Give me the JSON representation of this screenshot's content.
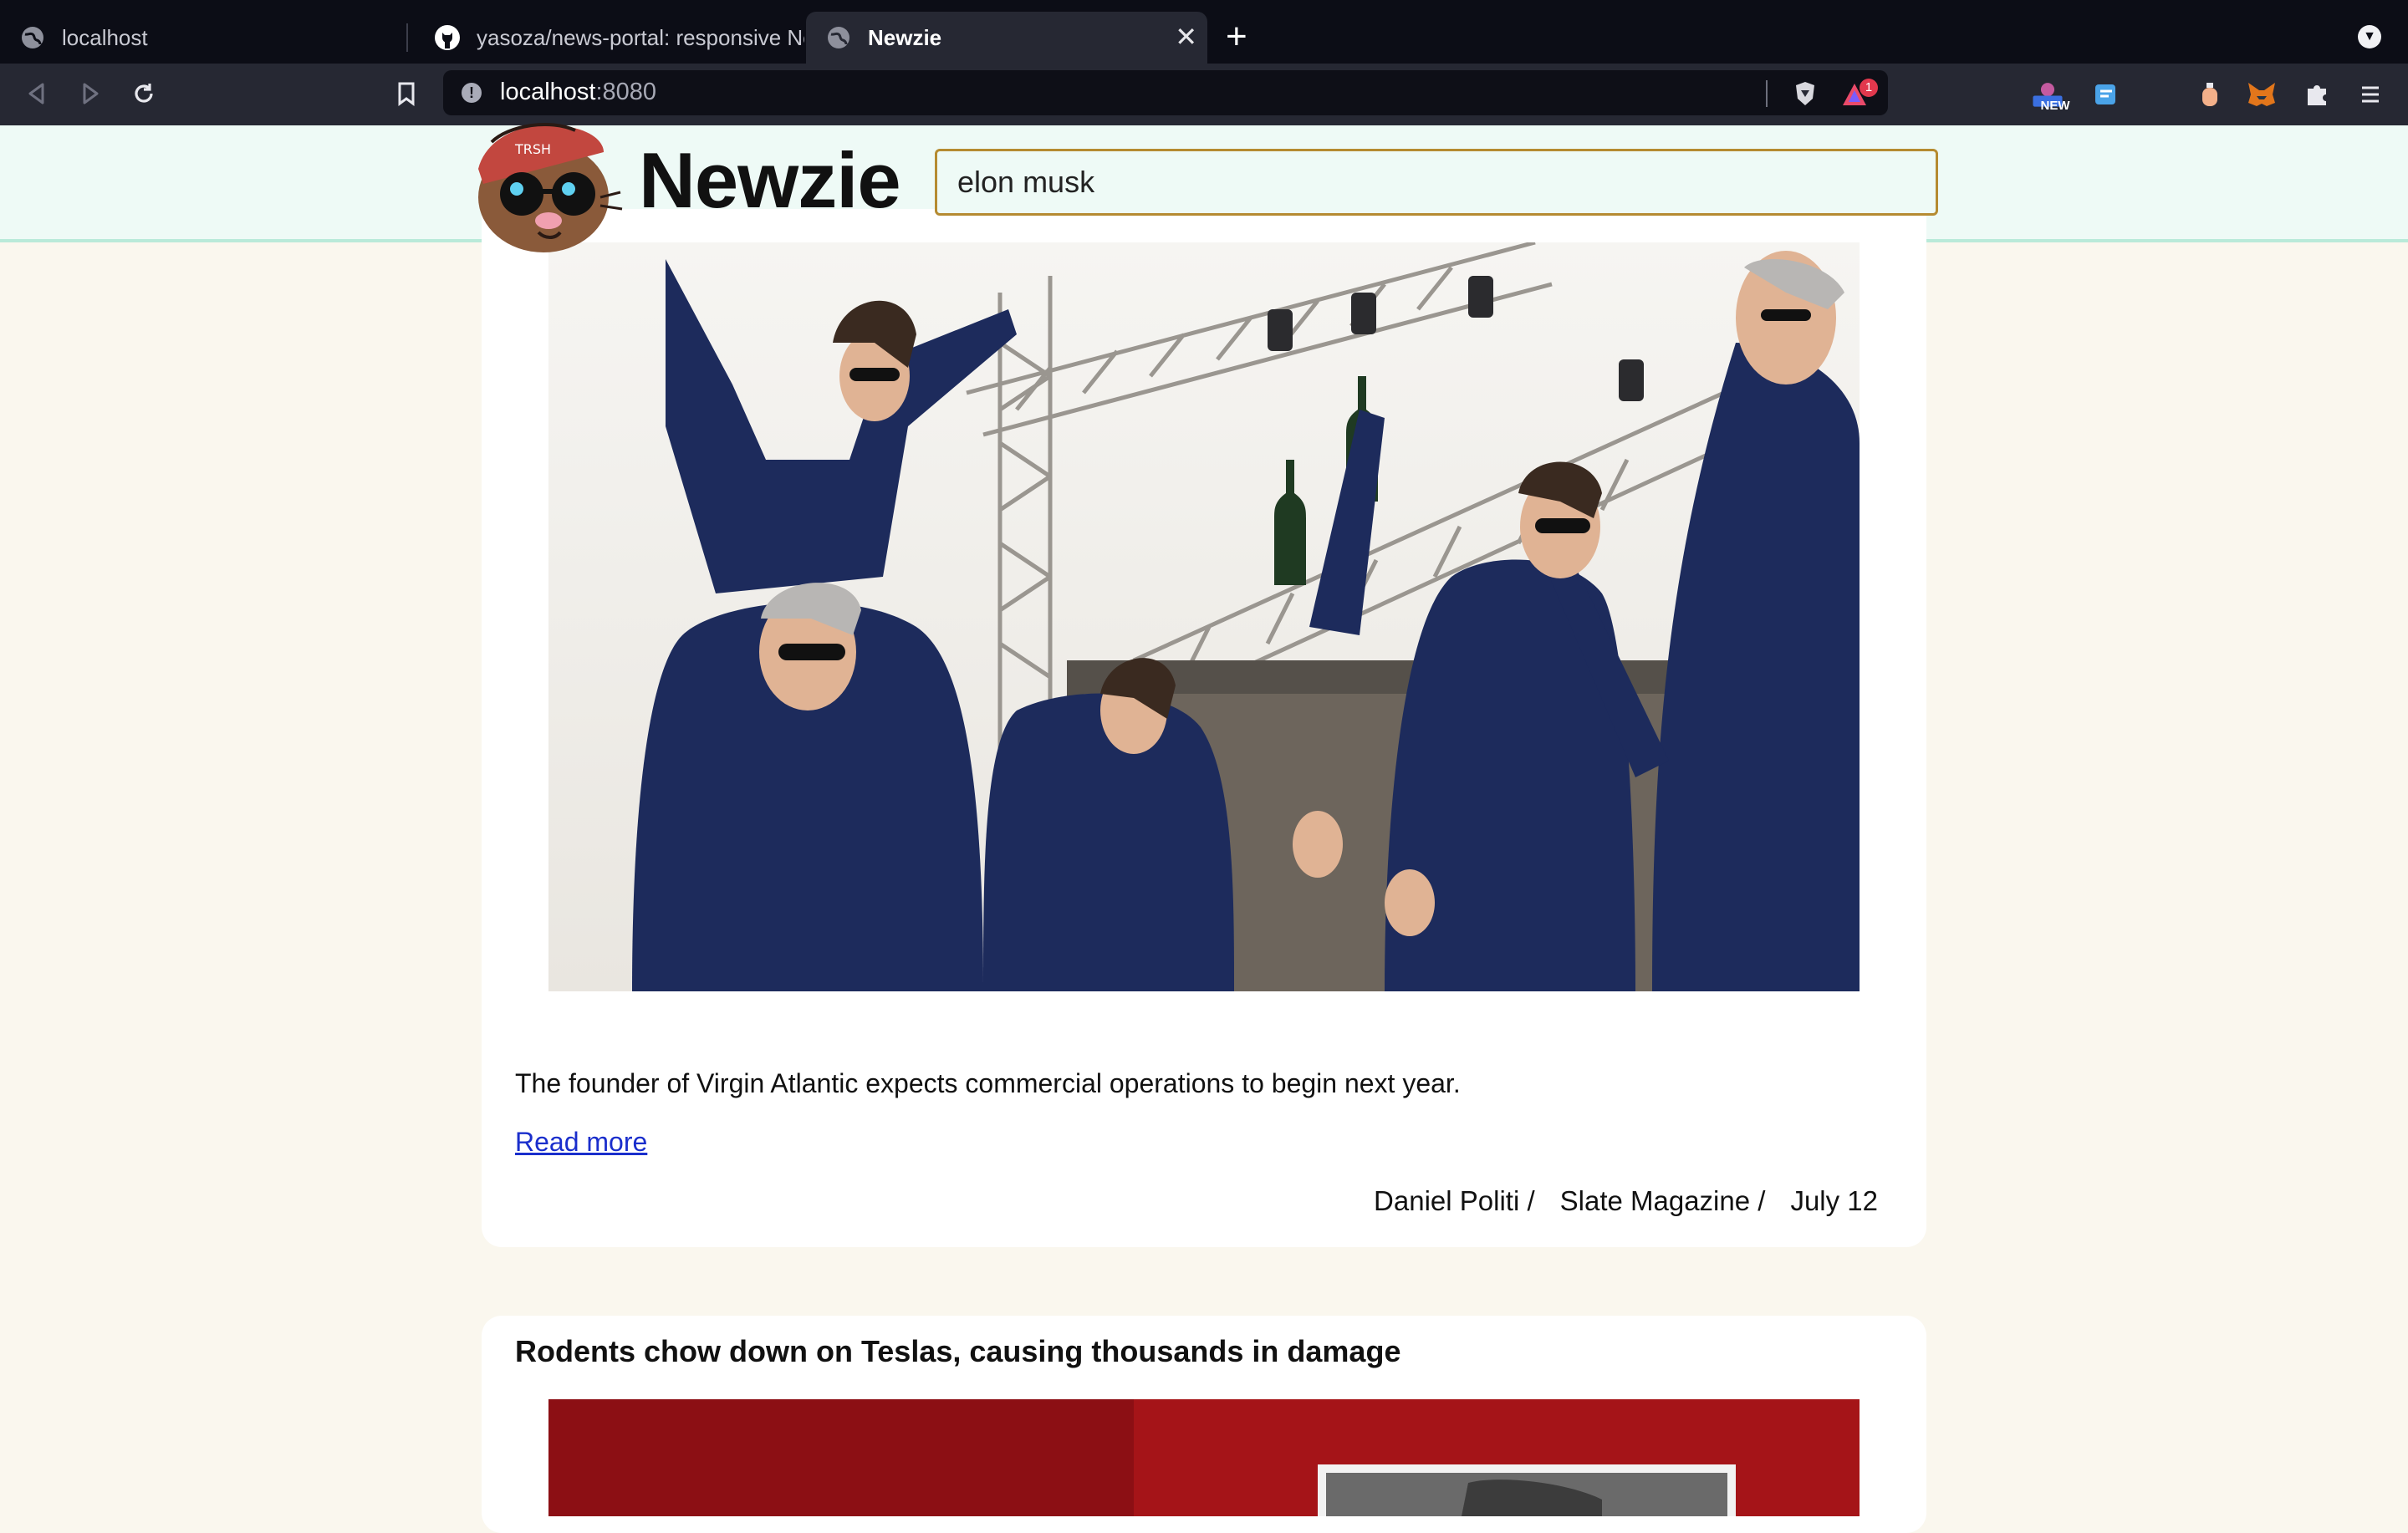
{
  "browser": {
    "tabs": [
      {
        "label": "localhost",
        "active": false
      },
      {
        "label": "yasoza/news-portal: responsive Ne",
        "active": false
      },
      {
        "label": "Newzie",
        "active": true
      }
    ],
    "new_tab_symbol": "+",
    "close_symbol": "✕",
    "url_host": "localhost",
    "url_port": ":8080",
    "notification_count": "1",
    "extension_badge": "NEW",
    "icons": [
      "back-icon",
      "forward-icon",
      "reload-icon",
      "bookmark-icon",
      "site-info-icon",
      "brave-shields-icon",
      "brave-rewards-icon",
      "extensions-puzzle-icon",
      "metamask-fox-icon",
      "menu-icon"
    ]
  },
  "site": {
    "brand": "Newzie",
    "search_value": "elon musk"
  },
  "articles": [
    {
      "description": "The founder of Virgin Atlantic expects commercial operations to begin next year.",
      "read_more": "Read more",
      "author": "Daniel Politi /",
      "source": "Slate Magazine /",
      "date": "July 12"
    },
    {
      "title": "Rodents chow down on Teslas, causing thousands in damage"
    }
  ],
  "colors": {
    "header_bg": "#eefaf6",
    "page_bg": "#faf7ee",
    "search_border": "#b58b31",
    "link": "#1a2ecc"
  }
}
